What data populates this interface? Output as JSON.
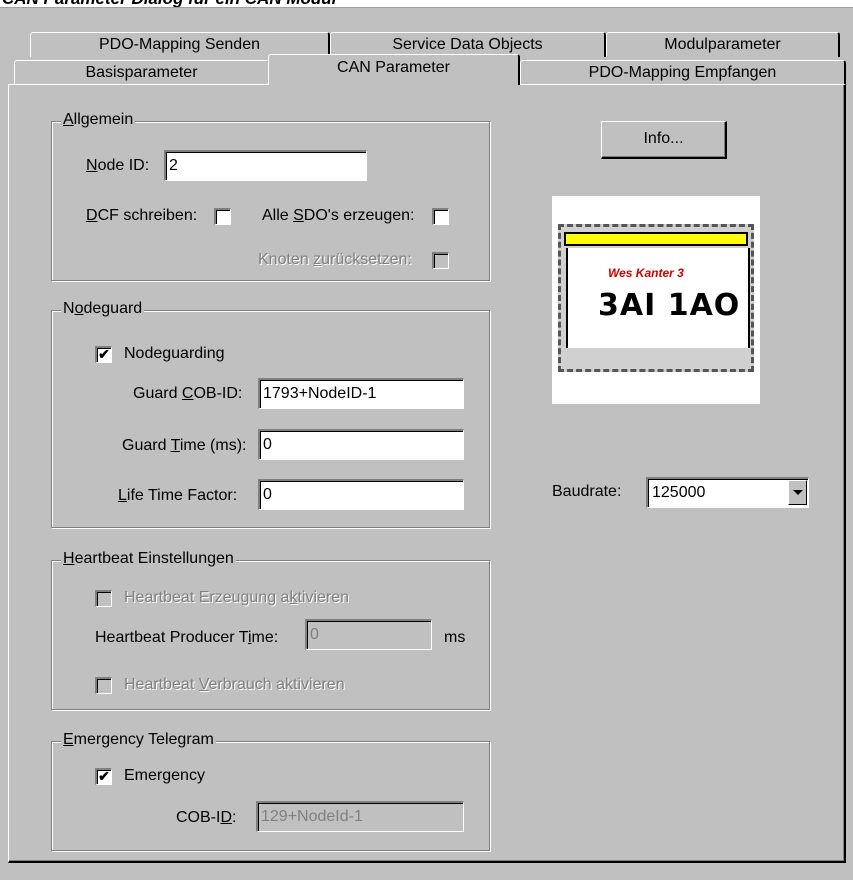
{
  "window_title": "CAN Parameter Dialog für ein CAN Modul",
  "tabs_back": [
    "PDO-Mapping Senden",
    "Service Data Objects",
    "Modulparameter"
  ],
  "tabs_front": [
    "Basisparameter",
    "CAN Parameter",
    "PDO-Mapping Empfangen"
  ],
  "active_tab": "CAN Parameter",
  "allgemein": {
    "title_pre": "",
    "title_u": "A",
    "title_post": "llgemein",
    "node_id_pre": "",
    "node_id_u": "N",
    "node_id_post": "ode ID:",
    "node_id_value": "2",
    "dcf_pre": "",
    "dcf_u": "D",
    "dcf_post": "CF schreiben:",
    "dcf_checked": "",
    "sdo_pre": "Alle ",
    "sdo_u": "S",
    "sdo_post": "DO's erzeugen:",
    "sdo_checked": "",
    "reset_pre": "Knoten ",
    "reset_u": "z",
    "reset_post": "urücksetzen:",
    "reset_checked": ""
  },
  "info_button": "Info...",
  "module_image": {
    "brand": "Wes Kanter 3",
    "model": "3AI 1AO"
  },
  "nodeguard": {
    "title_pre": "N",
    "title_u": "o",
    "title_post": "deguard",
    "nodeguarding_label": "Nodeguarding",
    "nodeguarding_checked": "✔",
    "cob_pre": "Guard ",
    "cob_u": "C",
    "cob_post": "OB-ID:",
    "cob_value": "1793+NodeID-1",
    "time_pre": "Guard ",
    "time_u": "T",
    "time_post": "ime (ms):",
    "time_value": "0",
    "life_pre": "",
    "life_u": "L",
    "life_post": "ife Time Factor:",
    "life_value": "0"
  },
  "baudrate": {
    "label": "Baudrate:",
    "value": "125000"
  },
  "heartbeat": {
    "title_pre": "",
    "title_u": "H",
    "title_post": "eartbeat Einstellungen",
    "producer_enable_pre": "Heartbeat Erzeugung a",
    "producer_enable_u": "k",
    "producer_enable_post": "tivieren",
    "producer_time_pre": "Heartbeat Producer T",
    "producer_time_u": "i",
    "producer_time_post": "me:",
    "producer_time_value": "0",
    "producer_time_unit": "ms",
    "consumer_pre": "Heartbeat ",
    "consumer_u": "V",
    "consumer_post": "erbrauch aktivieren"
  },
  "emergency": {
    "title_pre": "",
    "title_u": "E",
    "title_post": "mergency Telegram",
    "label_pre": "Emer",
    "label_u": "g",
    "label_post": "ency",
    "checked": "✔",
    "cob_pre": "COB-I",
    "cob_u": "D",
    "cob_post": ":",
    "cob_value": "129+NodeId-1"
  }
}
